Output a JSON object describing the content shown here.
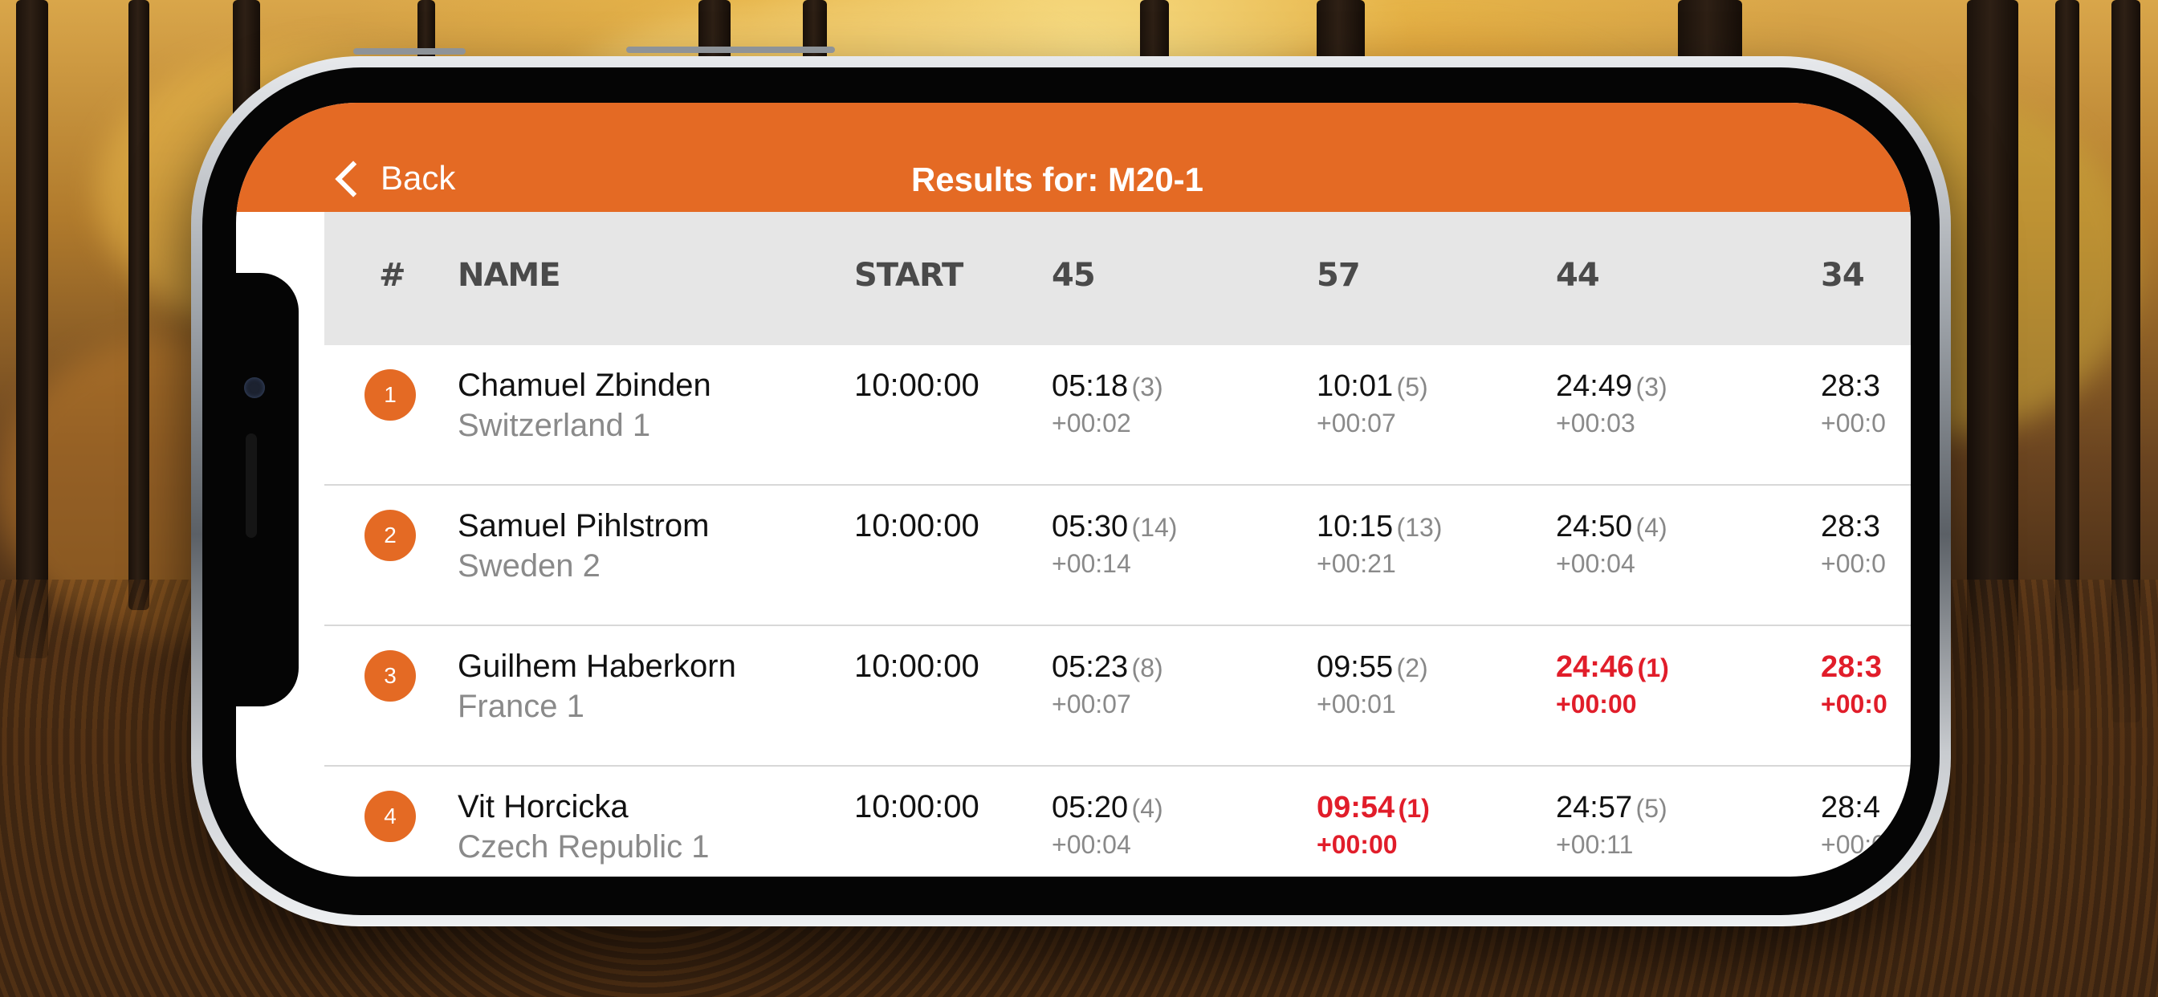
{
  "nav": {
    "back_label": "Back",
    "title": "Results for: M20-1"
  },
  "table": {
    "columns": [
      "#",
      "NAME",
      "START",
      "45",
      "57",
      "44",
      "34"
    ],
    "rows": [
      {
        "rank": "1",
        "name": "Chamuel Zbinden",
        "team": "Switzerland 1",
        "start": "10:00:00",
        "splits": [
          {
            "time": "05:18",
            "place": "(3)",
            "diff": "+00:02",
            "best": false
          },
          {
            "time": "10:01",
            "place": "(5)",
            "diff": "+00:07",
            "best": false
          },
          {
            "time": "24:49",
            "place": "(3)",
            "diff": "+00:03",
            "best": false
          },
          {
            "time": "28:3",
            "place": "",
            "diff": "+00:0",
            "best": false
          }
        ]
      },
      {
        "rank": "2",
        "name": "Samuel Pihlstrom",
        "team": "Sweden 2",
        "start": "10:00:00",
        "splits": [
          {
            "time": "05:30",
            "place": "(14)",
            "diff": "+00:14",
            "best": false
          },
          {
            "time": "10:15",
            "place": "(13)",
            "diff": "+00:21",
            "best": false
          },
          {
            "time": "24:50",
            "place": "(4)",
            "diff": "+00:04",
            "best": false
          },
          {
            "time": "28:3",
            "place": "",
            "diff": "+00:0",
            "best": false
          }
        ]
      },
      {
        "rank": "3",
        "name": "Guilhem Haberkorn",
        "team": "France 1",
        "start": "10:00:00",
        "splits": [
          {
            "time": "05:23",
            "place": "(8)",
            "diff": "+00:07",
            "best": false
          },
          {
            "time": "09:55",
            "place": "(2)",
            "diff": "+00:01",
            "best": false
          },
          {
            "time": "24:46",
            "place": "(1)",
            "diff": "+00:00",
            "best": true
          },
          {
            "time": "28:3",
            "place": "",
            "diff": "+00:0",
            "best": true
          }
        ]
      },
      {
        "rank": "4",
        "name": "Vit Horcicka",
        "team": "Czech Republic 1",
        "start": "10:00:00",
        "splits": [
          {
            "time": "05:20",
            "place": "(4)",
            "diff": "+00:04",
            "best": false
          },
          {
            "time": "09:54",
            "place": "(1)",
            "diff": "+00:00",
            "best": true
          },
          {
            "time": "24:57",
            "place": "(5)",
            "diff": "+00:11",
            "best": false
          },
          {
            "time": "28:4",
            "place": "",
            "diff": "+00:0",
            "best": false
          }
        ]
      }
    ]
  },
  "colors": {
    "accent": "#e46a24",
    "best": "#e11d2a",
    "header_bg": "#e6e6e6"
  }
}
